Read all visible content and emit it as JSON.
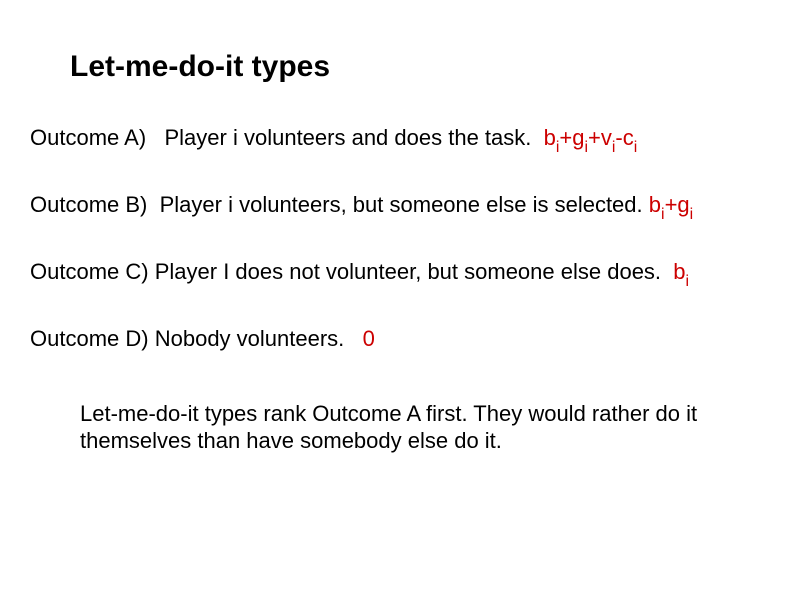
{
  "title": "Let-me-do-it types",
  "outcomes": {
    "a": {
      "label": "Outcome A)",
      "text": "Player i volunteers and does the task.",
      "payoff_parts": [
        "b",
        "+g",
        "+v",
        "-c"
      ],
      "subs": [
        "i",
        "i",
        "i",
        "i"
      ]
    },
    "b": {
      "label": "Outcome B)",
      "text": "Player i  volunteers, but someone else is selected.",
      "payoff_parts": [
        "b",
        "+g"
      ],
      "subs": [
        "i",
        "i"
      ]
    },
    "c": {
      "label": "Outcome C)",
      "text": "Player I does not volunteer, but someone else does.",
      "payoff_parts": [
        "b"
      ],
      "subs": [
        "i"
      ]
    },
    "d": {
      "label": "Outcome D)",
      "text": "Nobody volunteers.",
      "payoff_plain": "0"
    }
  },
  "footer": "Let-me-do-it types rank Outcome A first.  They would rather do it themselves than have somebody else do it."
}
